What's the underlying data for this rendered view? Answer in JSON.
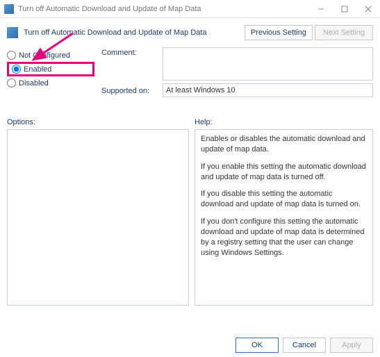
{
  "window": {
    "title": "Turn off Automatic Download and Update of Map Data"
  },
  "header": {
    "title": "Turn off Automatic Download and Update of Map Data",
    "previous_setting": "Previous Setting",
    "next_setting": "Next Setting"
  },
  "state": {
    "not_configured_label": "Not Configured",
    "enabled_label": "Enabled",
    "disabled_label": "Disabled",
    "selected": "enabled"
  },
  "fields": {
    "comment_label": "Comment:",
    "comment_value": "",
    "supported_label": "Supported on:",
    "supported_value": "At least Windows 10"
  },
  "sections": {
    "options_label": "Options:",
    "help_label": "Help:"
  },
  "help": {
    "p1": "Enables or disables the automatic download and update of map data.",
    "p2": "If you enable this setting the automatic download and update of map data is turned off.",
    "p3": "If you disable this setting the automatic download and update of map data is turned on.",
    "p4": "If you don't configure this setting the automatic download and update of map data is determined by a registry setting that the user can change using Windows Settings."
  },
  "footer": {
    "ok": "OK",
    "cancel": "Cancel",
    "apply": "Apply"
  }
}
